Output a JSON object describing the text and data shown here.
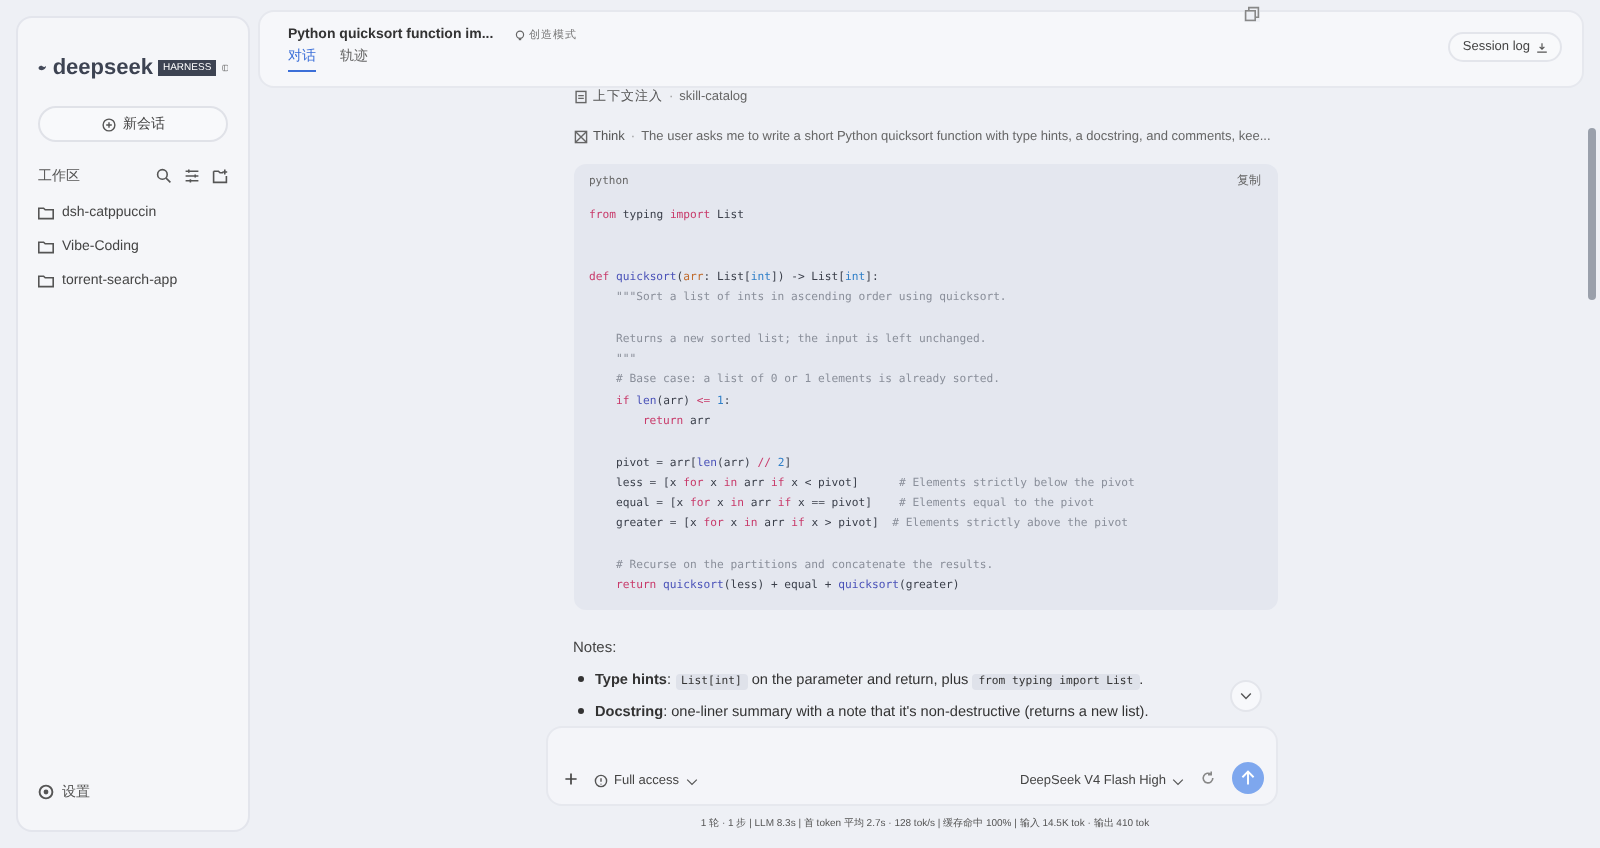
{
  "sidebar": {
    "logo": "deepseek",
    "badge": "HARNESS",
    "new_chat": "新会话",
    "section": "工作区",
    "items": [
      {
        "label": "dsh-catppuccin"
      },
      {
        "label": "Vibe-Coding"
      },
      {
        "label": "torrent-search-app"
      }
    ],
    "settings": "设置"
  },
  "header": {
    "title": "Python quicksort function im...",
    "mode": "创造模式",
    "tabs": [
      {
        "label": "对话",
        "selected": true
      },
      {
        "label": "轨迹",
        "selected": false
      }
    ],
    "session_log": "Session log"
  },
  "steps": [
    {
      "kind": "context",
      "label": "上下文注入",
      "separator": "·",
      "detail": "skill-catalog"
    },
    {
      "kind": "think",
      "label": "Think",
      "separator": "·",
      "detail": "The user asks me to write a short Python quicksort function with type hints, a docstring, and comments, kee..."
    }
  ],
  "code": {
    "language": "python",
    "copy": "复制",
    "lines": [
      {
        "tokens": [
          {
            "text": "from",
            "kind": "keyword"
          },
          {
            "text": " typing ",
            "kind": "plain"
          },
          {
            "text": "import",
            "kind": "keyword"
          },
          {
            "text": " List",
            "kind": "plain"
          }
        ]
      },
      {
        "blank": true
      },
      {
        "blank": true
      },
      {
        "tokens": [
          {
            "text": "def",
            "kind": "keyword"
          },
          {
            "text": " quicksort",
            "kind": "function"
          },
          {
            "text": "(",
            "kind": "plain"
          },
          {
            "text": "arr",
            "kind": "parameter"
          },
          {
            "text": ": List[",
            "kind": "plain"
          },
          {
            "text": "int",
            "kind": "number"
          },
          {
            "text": "]) -> List[",
            "kind": "plain"
          },
          {
            "text": "int",
            "kind": "number"
          },
          {
            "text": "]:",
            "kind": "plain"
          }
        ]
      },
      {
        "tokens": [
          {
            "text": "    \"\"\"Sort a list of ints in ascending order using quicksort.",
            "kind": "comment"
          }
        ]
      },
      {
        "blank": true
      },
      {
        "tokens": [
          {
            "text": "    Returns a new sorted list; the input is left unchanged.",
            "kind": "comment"
          }
        ]
      },
      {
        "tokens": [
          {
            "text": "    \"\"\"",
            "kind": "comment"
          }
        ]
      },
      {
        "tokens": [
          {
            "text": "    # Base case: a list of 0 or 1 elements is already sorted.",
            "kind": "comment"
          }
        ]
      },
      {
        "tokens": [
          {
            "text": "    if",
            "kind": "keyword"
          },
          {
            "text": " len",
            "kind": "function"
          },
          {
            "text": "(arr) ",
            "kind": "plain"
          },
          {
            "text": "<=",
            "kind": "keyword"
          },
          {
            "text": " 1",
            "kind": "number"
          },
          {
            "text": ":",
            "kind": "plain"
          }
        ]
      },
      {
        "tokens": [
          {
            "text": "        return",
            "kind": "keyword"
          },
          {
            "text": " arr",
            "kind": "plain"
          }
        ]
      },
      {
        "blank": true
      },
      {
        "tokens": [
          {
            "text": "    pivot = arr[",
            "kind": "plain"
          },
          {
            "text": "len",
            "kind": "function"
          },
          {
            "text": "(arr) ",
            "kind": "plain"
          },
          {
            "text": "//",
            "kind": "keyword"
          },
          {
            "text": " 2",
            "kind": "number"
          },
          {
            "text": "]",
            "kind": "plain"
          }
        ]
      },
      {
        "tokens": [
          {
            "text": "    less = [x ",
            "kind": "plain"
          },
          {
            "text": "for",
            "kind": "keyword"
          },
          {
            "text": " x ",
            "kind": "plain"
          },
          {
            "text": "in",
            "kind": "keyword"
          },
          {
            "text": " arr ",
            "kind": "plain"
          },
          {
            "text": "if",
            "kind": "keyword"
          },
          {
            "text": " x < pivot]      ",
            "kind": "plain"
          },
          {
            "text": "# Elements strictly below the pivot",
            "kind": "comment"
          }
        ]
      },
      {
        "tokens": [
          {
            "text": "    equal = [x ",
            "kind": "plain"
          },
          {
            "text": "for",
            "kind": "keyword"
          },
          {
            "text": " x ",
            "kind": "plain"
          },
          {
            "text": "in",
            "kind": "keyword"
          },
          {
            "text": " arr ",
            "kind": "plain"
          },
          {
            "text": "if",
            "kind": "keyword"
          },
          {
            "text": " x == pivot]    ",
            "kind": "plain"
          },
          {
            "text": "# Elements equal to the pivot",
            "kind": "comment"
          }
        ]
      },
      {
        "tokens": [
          {
            "text": "    greater = [x ",
            "kind": "plain"
          },
          {
            "text": "for",
            "kind": "keyword"
          },
          {
            "text": " x ",
            "kind": "plain"
          },
          {
            "text": "in",
            "kind": "keyword"
          },
          {
            "text": " arr ",
            "kind": "plain"
          },
          {
            "text": "if",
            "kind": "keyword"
          },
          {
            "text": " x > pivot]  ",
            "kind": "plain"
          },
          {
            "text": "# Elements strictly above the pivot",
            "kind": "comment"
          }
        ]
      },
      {
        "blank": true
      },
      {
        "tokens": [
          {
            "text": "    # Recurse on the partitions and concatenate the results.",
            "kind": "comment"
          }
        ]
      },
      {
        "tokens": [
          {
            "text": "    return",
            "kind": "keyword"
          },
          {
            "text": " quicksort",
            "kind": "function"
          },
          {
            "text": "(less) + equal + ",
            "kind": "plain"
          },
          {
            "text": "quicksort",
            "kind": "function"
          },
          {
            "text": "(greater)",
            "kind": "plain"
          }
        ]
      }
    ]
  },
  "notes_heading": "Notes:",
  "bullets": [
    [
      {
        "text": "Type hints",
        "kind": "bold"
      },
      {
        "text": ": ",
        "kind": "plain"
      },
      {
        "text": "List[int]",
        "kind": "code"
      },
      {
        "text": " on the parameter and return, plus ",
        "kind": "plain"
      },
      {
        "text": "from typing import List",
        "kind": "code"
      },
      {
        "text": ".",
        "kind": "plain"
      }
    ],
    [
      {
        "text": "Docstring",
        "kind": "bold"
      },
      {
        "text": ": one-liner summary with a note that it's non-destructive (returns a new list).",
        "kind": "plain"
      }
    ]
  ],
  "composer": {
    "access": "Full access",
    "model": "DeepSeek V4 Flash High"
  },
  "status_bar": "1 轮 · 1 步 | LLM 8.3s | 首 token 平均 2.7s · 128 tok/s | 缓存命中 100% | 输入 14.5K tok · 输出 410 tok"
}
